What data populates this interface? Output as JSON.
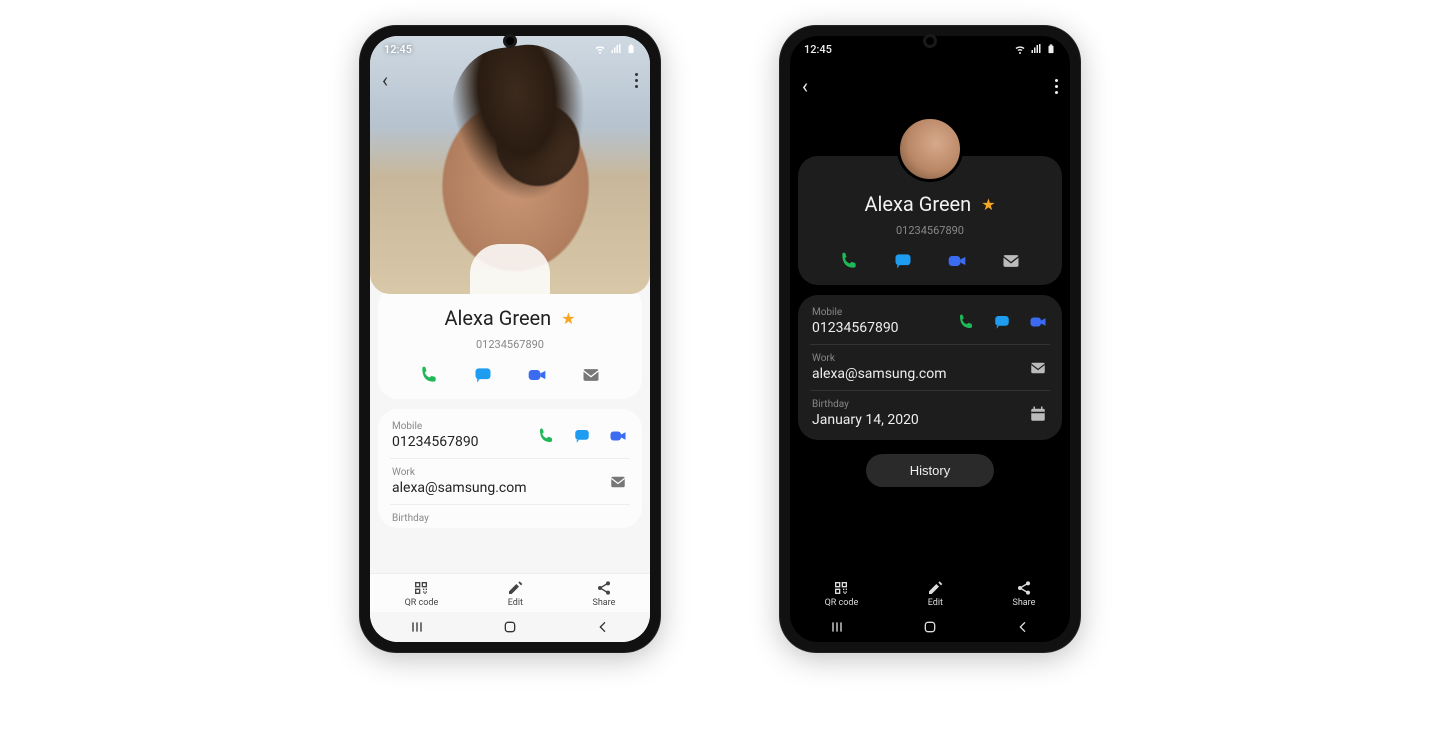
{
  "status": {
    "time": "12:45"
  },
  "contact": {
    "name": "Alexa Green",
    "number": "01234567890"
  },
  "details": {
    "mobile": {
      "label": "Mobile",
      "value": "01234567890"
    },
    "work": {
      "label": "Work",
      "value": "alexa@samsung.com"
    },
    "birthday": {
      "label": "Birthday",
      "value": "January 14, 2020"
    }
  },
  "buttons": {
    "history": "History"
  },
  "bottombar": {
    "qr": "QR code",
    "edit": "Edit",
    "share": "Share"
  }
}
